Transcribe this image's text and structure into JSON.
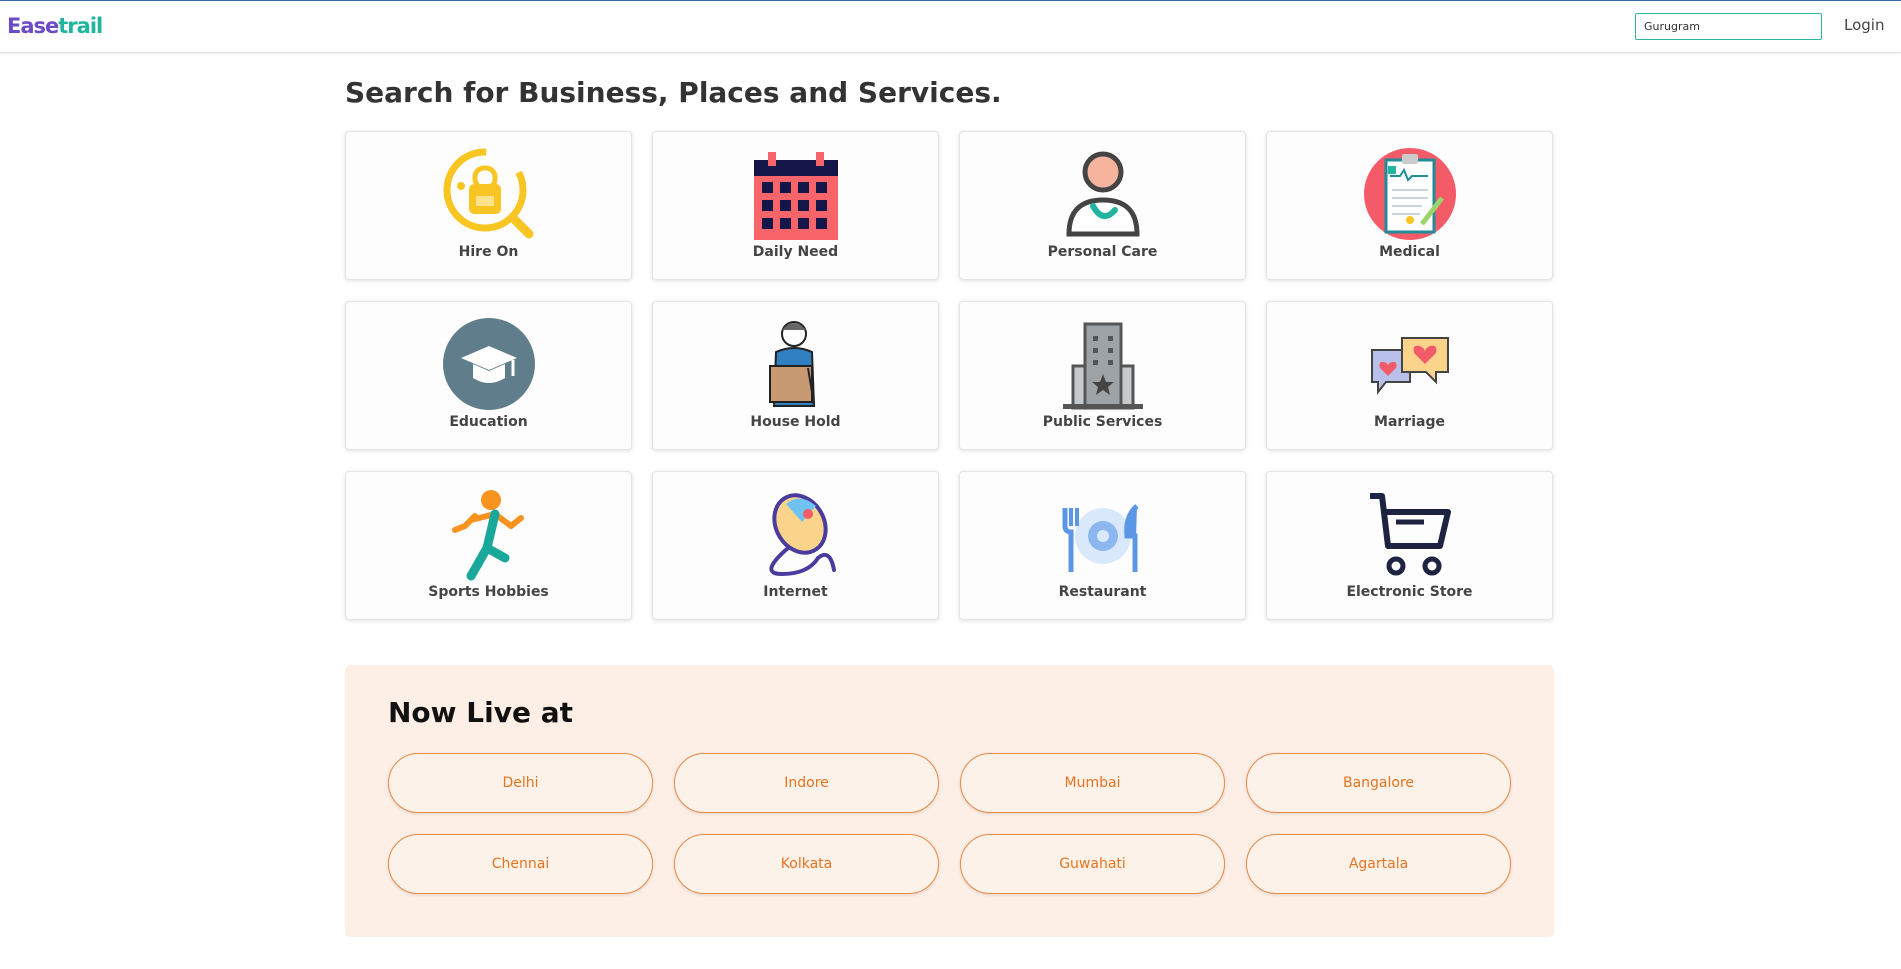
{
  "header": {
    "logo_part1": "Ease",
    "logo_part2": "trail",
    "city_value": "Gurugram",
    "login_label": "Login"
  },
  "main": {
    "heading": "Search for Business, Places and Services."
  },
  "categories": [
    {
      "label": "Hire On",
      "icon": "hire-on-icon"
    },
    {
      "label": "Daily Need",
      "icon": "calendar-icon"
    },
    {
      "label": "Personal Care",
      "icon": "person-icon"
    },
    {
      "label": "Medical",
      "icon": "medical-clipboard-icon"
    },
    {
      "label": "Education",
      "icon": "graduation-cap-icon"
    },
    {
      "label": "House Hold",
      "icon": "delivery-man-icon"
    },
    {
      "label": "Public Services",
      "icon": "building-icon"
    },
    {
      "label": "Marriage",
      "icon": "heart-chat-icon"
    },
    {
      "label": "Sports Hobbies",
      "icon": "runner-icon"
    },
    {
      "label": "Internet",
      "icon": "mouse-icon"
    },
    {
      "label": "Restaurant",
      "icon": "plate-cutlery-icon"
    },
    {
      "label": "Electronic Store",
      "icon": "shopping-cart-icon"
    }
  ],
  "live": {
    "title": "Now Live at",
    "cities": [
      "Delhi",
      "Indore",
      "Mumbai",
      "Bangalore",
      "Chennai",
      "Kolkata",
      "Guwahati",
      "Agartala"
    ]
  },
  "colors": {
    "brand_purple": "#6a4cc7",
    "brand_teal": "#21b5a0",
    "city_orange": "#e8741f",
    "live_background": "#fdefe6"
  }
}
